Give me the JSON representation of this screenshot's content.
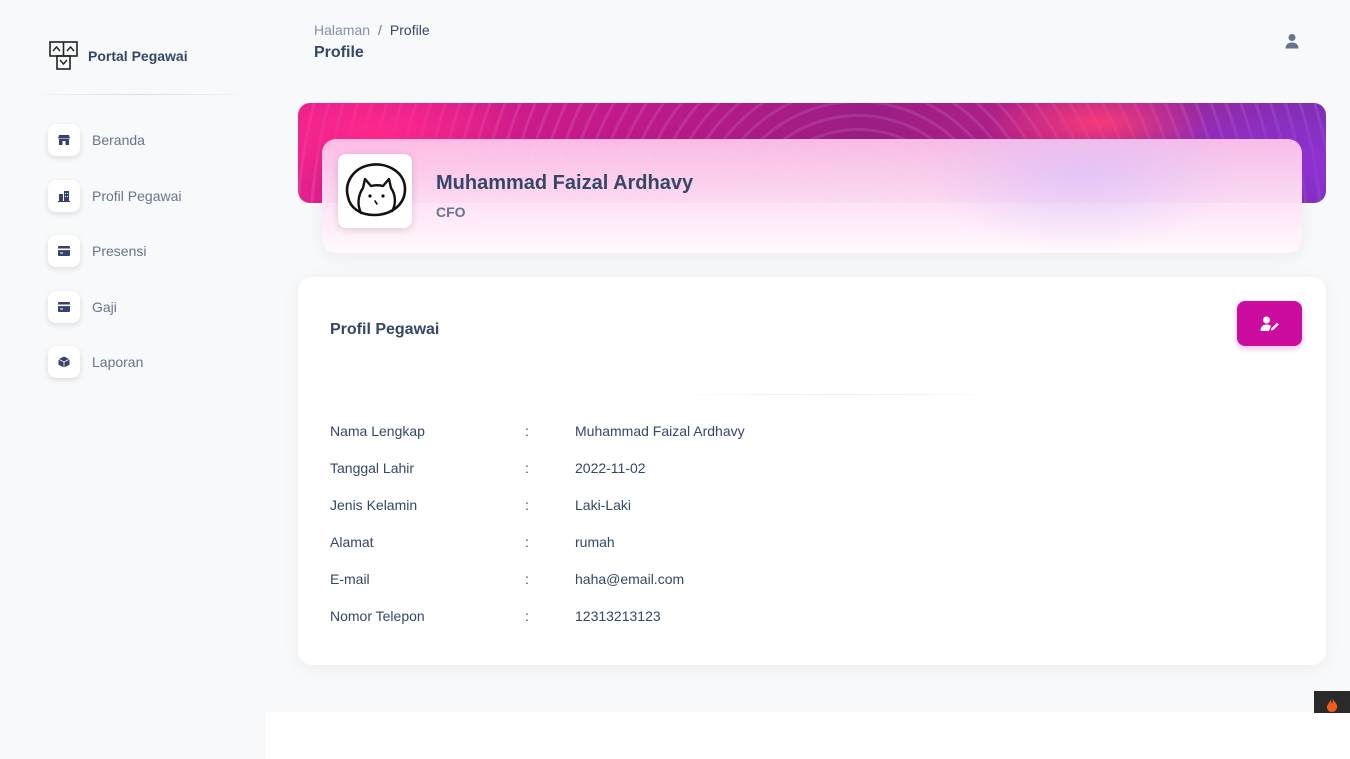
{
  "sidebar": {
    "brand": "Portal Pegawai",
    "items": [
      {
        "label": "Beranda",
        "icon": "shop-icon"
      },
      {
        "label": "Profil Pegawai",
        "icon": "office-icon"
      },
      {
        "label": "Presensi",
        "icon": "credit-card-icon"
      },
      {
        "label": "Gaji",
        "icon": "credit-card-icon"
      },
      {
        "label": "Laporan",
        "icon": "box-icon"
      }
    ]
  },
  "header": {
    "breadcrumb_parent": "Halaman",
    "breadcrumb_separator": "/",
    "breadcrumb_current": "Profile",
    "title": "Profile"
  },
  "profile": {
    "name": "Muhammad Faizal Ardhavy",
    "role": "CFO"
  },
  "details": {
    "title": "Profil Pegawai",
    "rows": [
      {
        "label": "Nama Lengkap",
        "value": "Muhammad Faizal Ardhavy"
      },
      {
        "label": "Tanggal Lahir",
        "value": "2022-11-02"
      },
      {
        "label": "Jenis Kelamin",
        "value": "Laki-Laki"
      },
      {
        "label": "Alamat",
        "value": "rumah"
      },
      {
        "label": "E-mail",
        "value": "haha@email.com"
      },
      {
        "label": "Nomor Telepon",
        "value": "12313213123"
      }
    ],
    "colon": ":"
  },
  "colors": {
    "accent": "#cb0c9f",
    "text": "#344767",
    "muted": "#67748e"
  }
}
